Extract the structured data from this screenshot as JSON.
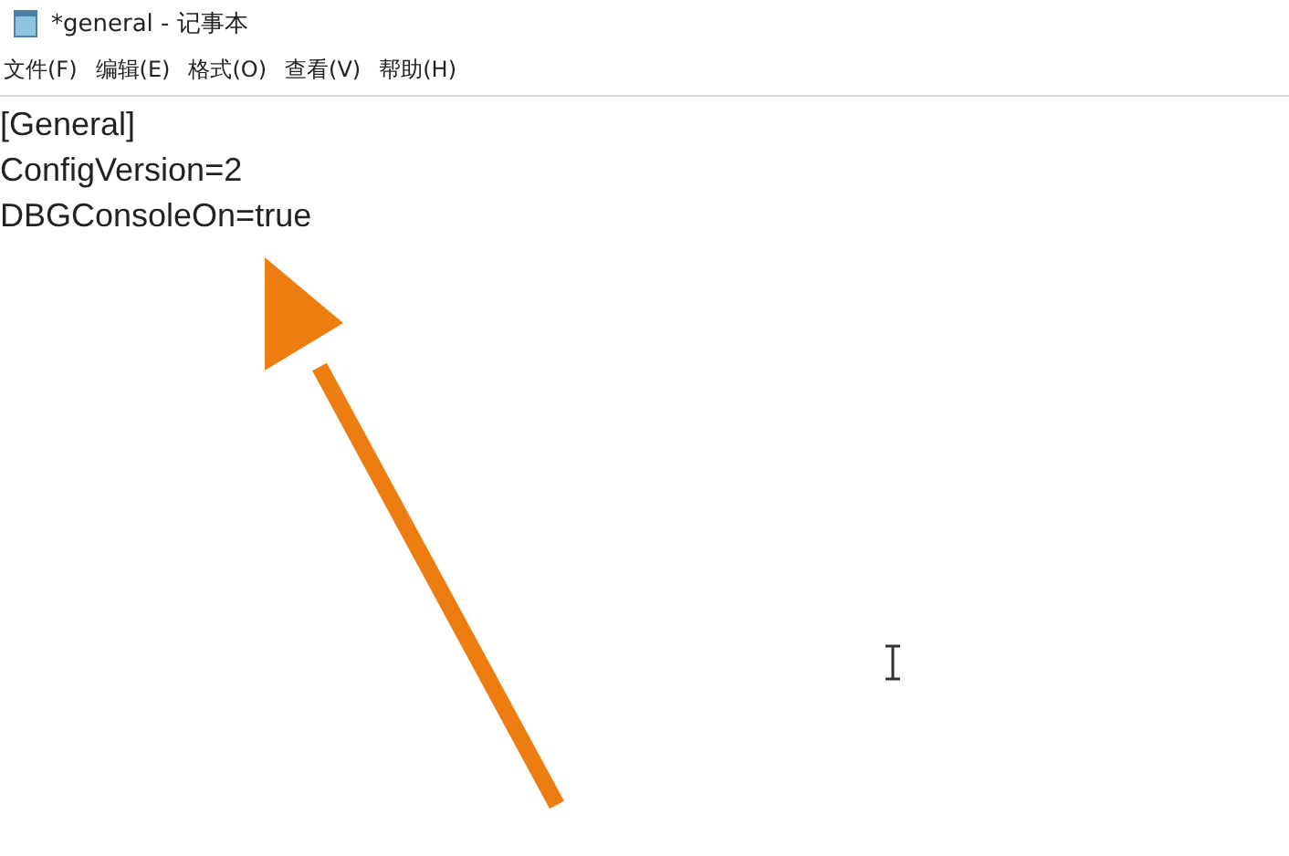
{
  "window": {
    "title": "*general - 记事本"
  },
  "menu": [
    "文件(F)",
    "编辑(E)",
    "格式(O)",
    "查看(V)",
    "帮助(H)"
  ],
  "editor": {
    "lines": [
      "[General]",
      "ConfigVersion=2",
      "DBGConsoleOn=true"
    ]
  }
}
